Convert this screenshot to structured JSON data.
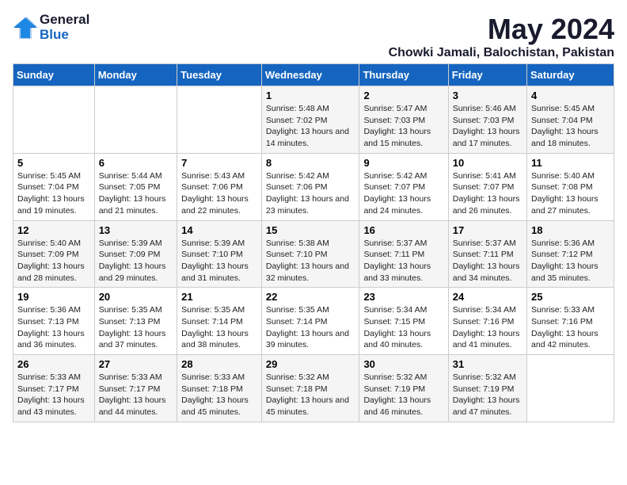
{
  "logo": {
    "general": "General",
    "blue": "Blue"
  },
  "header": {
    "month": "May 2024",
    "location": "Chowki Jamali, Balochistan, Pakistan"
  },
  "days_of_week": [
    "Sunday",
    "Monday",
    "Tuesday",
    "Wednesday",
    "Thursday",
    "Friday",
    "Saturday"
  ],
  "weeks": [
    [
      {
        "day": "",
        "info": ""
      },
      {
        "day": "",
        "info": ""
      },
      {
        "day": "",
        "info": ""
      },
      {
        "day": "1",
        "info": "Sunrise: 5:48 AM\nSunset: 7:02 PM\nDaylight: 13 hours and 14 minutes."
      },
      {
        "day": "2",
        "info": "Sunrise: 5:47 AM\nSunset: 7:03 PM\nDaylight: 13 hours and 15 minutes."
      },
      {
        "day": "3",
        "info": "Sunrise: 5:46 AM\nSunset: 7:03 PM\nDaylight: 13 hours and 17 minutes."
      },
      {
        "day": "4",
        "info": "Sunrise: 5:45 AM\nSunset: 7:04 PM\nDaylight: 13 hours and 18 minutes."
      }
    ],
    [
      {
        "day": "5",
        "info": "Sunrise: 5:45 AM\nSunset: 7:04 PM\nDaylight: 13 hours and 19 minutes."
      },
      {
        "day": "6",
        "info": "Sunrise: 5:44 AM\nSunset: 7:05 PM\nDaylight: 13 hours and 21 minutes."
      },
      {
        "day": "7",
        "info": "Sunrise: 5:43 AM\nSunset: 7:06 PM\nDaylight: 13 hours and 22 minutes."
      },
      {
        "day": "8",
        "info": "Sunrise: 5:42 AM\nSunset: 7:06 PM\nDaylight: 13 hours and 23 minutes."
      },
      {
        "day": "9",
        "info": "Sunrise: 5:42 AM\nSunset: 7:07 PM\nDaylight: 13 hours and 24 minutes."
      },
      {
        "day": "10",
        "info": "Sunrise: 5:41 AM\nSunset: 7:07 PM\nDaylight: 13 hours and 26 minutes."
      },
      {
        "day": "11",
        "info": "Sunrise: 5:40 AM\nSunset: 7:08 PM\nDaylight: 13 hours and 27 minutes."
      }
    ],
    [
      {
        "day": "12",
        "info": "Sunrise: 5:40 AM\nSunset: 7:09 PM\nDaylight: 13 hours and 28 minutes."
      },
      {
        "day": "13",
        "info": "Sunrise: 5:39 AM\nSunset: 7:09 PM\nDaylight: 13 hours and 29 minutes."
      },
      {
        "day": "14",
        "info": "Sunrise: 5:39 AM\nSunset: 7:10 PM\nDaylight: 13 hours and 31 minutes."
      },
      {
        "day": "15",
        "info": "Sunrise: 5:38 AM\nSunset: 7:10 PM\nDaylight: 13 hours and 32 minutes."
      },
      {
        "day": "16",
        "info": "Sunrise: 5:37 AM\nSunset: 7:11 PM\nDaylight: 13 hours and 33 minutes."
      },
      {
        "day": "17",
        "info": "Sunrise: 5:37 AM\nSunset: 7:11 PM\nDaylight: 13 hours and 34 minutes."
      },
      {
        "day": "18",
        "info": "Sunrise: 5:36 AM\nSunset: 7:12 PM\nDaylight: 13 hours and 35 minutes."
      }
    ],
    [
      {
        "day": "19",
        "info": "Sunrise: 5:36 AM\nSunset: 7:13 PM\nDaylight: 13 hours and 36 minutes."
      },
      {
        "day": "20",
        "info": "Sunrise: 5:35 AM\nSunset: 7:13 PM\nDaylight: 13 hours and 37 minutes."
      },
      {
        "day": "21",
        "info": "Sunrise: 5:35 AM\nSunset: 7:14 PM\nDaylight: 13 hours and 38 minutes."
      },
      {
        "day": "22",
        "info": "Sunrise: 5:35 AM\nSunset: 7:14 PM\nDaylight: 13 hours and 39 minutes."
      },
      {
        "day": "23",
        "info": "Sunrise: 5:34 AM\nSunset: 7:15 PM\nDaylight: 13 hours and 40 minutes."
      },
      {
        "day": "24",
        "info": "Sunrise: 5:34 AM\nSunset: 7:16 PM\nDaylight: 13 hours and 41 minutes."
      },
      {
        "day": "25",
        "info": "Sunrise: 5:33 AM\nSunset: 7:16 PM\nDaylight: 13 hours and 42 minutes."
      }
    ],
    [
      {
        "day": "26",
        "info": "Sunrise: 5:33 AM\nSunset: 7:17 PM\nDaylight: 13 hours and 43 minutes."
      },
      {
        "day": "27",
        "info": "Sunrise: 5:33 AM\nSunset: 7:17 PM\nDaylight: 13 hours and 44 minutes."
      },
      {
        "day": "28",
        "info": "Sunrise: 5:33 AM\nSunset: 7:18 PM\nDaylight: 13 hours and 45 minutes."
      },
      {
        "day": "29",
        "info": "Sunrise: 5:32 AM\nSunset: 7:18 PM\nDaylight: 13 hours and 45 minutes."
      },
      {
        "day": "30",
        "info": "Sunrise: 5:32 AM\nSunset: 7:19 PM\nDaylight: 13 hours and 46 minutes."
      },
      {
        "day": "31",
        "info": "Sunrise: 5:32 AM\nSunset: 7:19 PM\nDaylight: 13 hours and 47 minutes."
      },
      {
        "day": "",
        "info": ""
      }
    ]
  ]
}
